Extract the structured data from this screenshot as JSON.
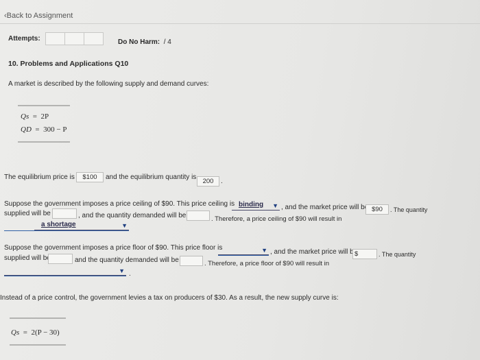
{
  "nav": {
    "back_label": "Back to Assignment"
  },
  "attempts": {
    "label": "Attempts:",
    "no_harm_label": "Do No Harm:",
    "no_harm_value": "/ 4"
  },
  "question": {
    "title": "10. Problems and Applications Q10",
    "intro": "A market is described by the following supply and demand curves:",
    "eq1_lhs": "Qs",
    "eq1_rhs": "2P",
    "eq2_lhs": "QD",
    "eq2_rhs": "300 − P",
    "equals": "="
  },
  "equilibrium": {
    "text1": "The equilibrium price is",
    "price_value": "$100",
    "text2": "and the equilibrium quantity is",
    "quantity_value": "200",
    "end": "."
  },
  "ceiling": {
    "line1_a": "Suppose the government imposes a price ceiling of $90. This price ceiling is",
    "binding_value": "binding",
    "line1_b": ", and the market price will be",
    "price_value": "$90",
    "line1_c": ". The quantity",
    "line2_a": "supplied will be",
    "line2_b": ", and the quantity demanded will be",
    "line2_c": ". Therefore, a price ceiling of $90 will result in",
    "result_value": "a shortage"
  },
  "floor": {
    "line1_a": "Suppose the government imposes a price floor of $90. This price floor is",
    "line1_b": ", and the market price will be",
    "price_value": "$",
    "line1_c": ". The quantity",
    "line2_a": "supplied will be",
    "line2_b": "and the quantity demanded will be",
    "line2_c": ". Therefore, a price floor of $90 will result in",
    "end": "."
  },
  "tax": {
    "text": "Instead of a price control, the government levies a tax on producers of $30. As a result, the new supply curve is:",
    "eq_lhs": "Qs",
    "equals": "=",
    "eq_rhs": "2(P − 30)"
  },
  "icons": {
    "back": "chevron-left-icon",
    "dropdown": "caret-down-icon"
  },
  "colors": {
    "link_blue": "#2f5fa5",
    "page_bg": "#e9e9e7"
  }
}
